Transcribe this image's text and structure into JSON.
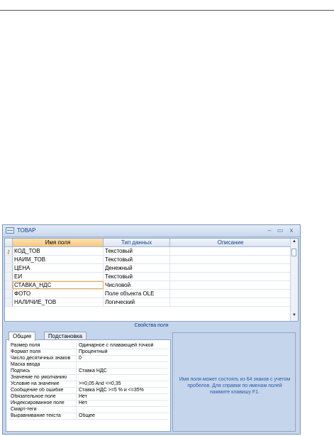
{
  "window": {
    "title": "ТОВАР",
    "minimize": "–",
    "maximize": "▭",
    "close": "x"
  },
  "grid": {
    "columns": [
      "Имя поля",
      "Тип данных",
      "Описание"
    ],
    "rows": [
      {
        "name": "КОД_ТОВ",
        "type": "Текстовый",
        "desc": "",
        "key": true
      },
      {
        "name": "НАИМ_ТОВ",
        "type": "Текстовый",
        "desc": ""
      },
      {
        "name": "ЦЕНА",
        "type": "Денежный",
        "desc": ""
      },
      {
        "name": "ЕИ",
        "type": "Текстовый",
        "desc": ""
      },
      {
        "name": "СТАВКА_НДС",
        "type": "Числовой",
        "desc": "",
        "current": true
      },
      {
        "name": "ФОТО",
        "type": "Поле объекта OLE",
        "desc": ""
      },
      {
        "name": "НАЛИЧИЕ_ТОВ",
        "type": "Логический",
        "desc": ""
      }
    ]
  },
  "properties": {
    "section_title": "Свойства поля",
    "tabs": [
      "Общие",
      "Подстановка"
    ],
    "rows": [
      {
        "label": "Размер поля",
        "value": "Одинарное с плавающей точкой"
      },
      {
        "label": "Формат поля",
        "value": "Процентный"
      },
      {
        "label": "Число десятичных знаков",
        "value": "0"
      },
      {
        "label": "Маска ввода",
        "value": ""
      },
      {
        "label": "Подпись",
        "value": "Ставка НДС"
      },
      {
        "label": "Значение по умолчанию",
        "value": ""
      },
      {
        "label": "Условие на значение",
        "value": ">=0,05 And <=0,35"
      },
      {
        "label": "Сообщение об ошибке",
        "value": "Ставка НДС >=5 % и <=35%"
      },
      {
        "label": "Обязательное поле",
        "value": "Нет"
      },
      {
        "label": "Индексированное поле",
        "value": "Нет"
      },
      {
        "label": "Смарт-теги",
        "value": ""
      },
      {
        "label": "Выравнивание текста",
        "value": "Общее"
      }
    ],
    "help_text": "Имя поля может состоять из 64 знаков с учетом пробелов.  Для справки по именам полей нажмите клавишу F1."
  },
  "icons": {
    "key": "key-icon",
    "table": "table-icon"
  }
}
